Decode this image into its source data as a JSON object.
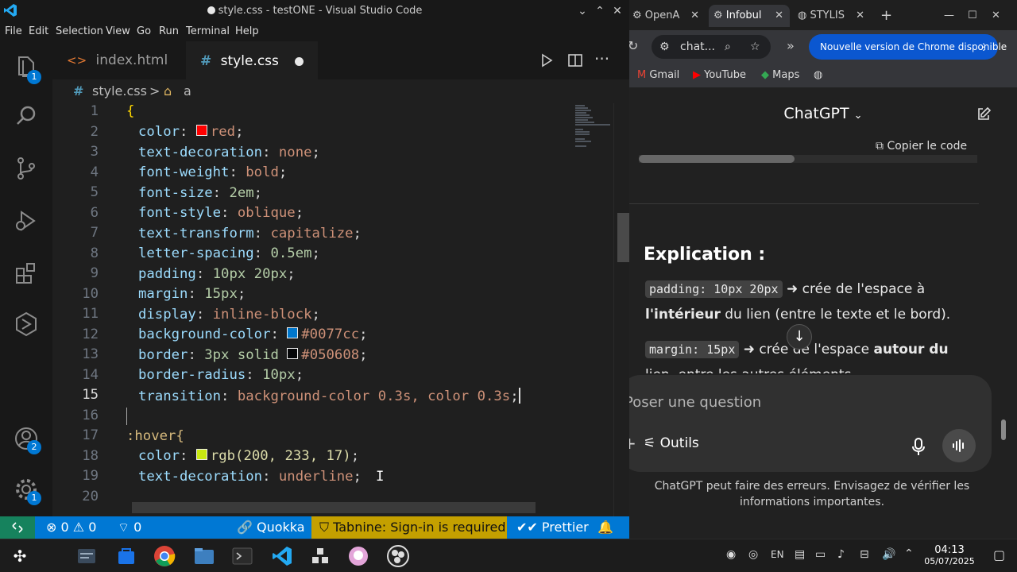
{
  "vscode": {
    "window_title": "style.css - testONE - Visual Studio Code",
    "menu": [
      "File",
      "Edit",
      "Selection",
      "View",
      "Go",
      "Run",
      "Terminal",
      "Help"
    ],
    "activity_badges": {
      "explorer": "1",
      "accounts": "2",
      "settings": "1"
    },
    "tabs": [
      {
        "label": "index.html",
        "icon": "<>",
        "active": false
      },
      {
        "label": "style.css",
        "icon": "#",
        "active": true,
        "modified": true
      }
    ],
    "breadcrumb": {
      "file": "style.css",
      "separator": ">",
      "symbol": "a"
    },
    "line_numbers": [
      "1",
      "2",
      "3",
      "4",
      "5",
      "6",
      "7",
      "8",
      "9",
      "10",
      "11",
      "12",
      "13",
      "14",
      "15",
      "16",
      "17",
      "18",
      "19",
      "20"
    ],
    "active_line": 15,
    "code_lines": {
      "l1": "{",
      "l2_prop": "color",
      "l2_val": "red",
      "l2_swatch": "#ff0000",
      "l3_prop": "text-decoration",
      "l3_val": "none",
      "l4_prop": "font-weight",
      "l4_val": "bold",
      "l5_prop": "font-size",
      "l5_val": "2em",
      "l6_prop": "font-style",
      "l6_val": "oblique",
      "l7_prop": "text-transform",
      "l7_val": "capitalize",
      "l8_prop": "letter-spacing",
      "l8_val": "0.5em",
      "l9_prop": "padding",
      "l9_val": "10px 20px",
      "l10_prop": "margin",
      "l10_val": "15px",
      "l11_prop": "display",
      "l11_val": "inline-block",
      "l12_prop": "background-color",
      "l12_val": "#0077cc",
      "l12_swatch": "#0077cc",
      "l13_prop": "border",
      "l13_val_a": "3px solid ",
      "l13_val_b": "#050608",
      "l13_swatch": "#050608",
      "l14_prop": "border-radius",
      "l14_val": "10px",
      "l15_prop": "transition",
      "l15_val": "background-color 0.3s, color 0.3s",
      "l17_sel": ":hover{",
      "l18_prop": "color",
      "l18_val": "rgb(200, 233, 17)",
      "l18_swatch": "#c8e911",
      "l19_prop": "text-decoration",
      "l19_val": "underline"
    },
    "status": {
      "errors": "0",
      "warnings": "0",
      "ports": "0",
      "quokka": "Quokka",
      "tabnine": "Tabnine: Sign-in is required",
      "prettier": "Prettier"
    }
  },
  "chrome": {
    "tabs": [
      "OpenA",
      "Infobul",
      "STYLIS"
    ],
    "omnibox": "chat...",
    "update_button": "Nouvelle version de Chrome disponible",
    "bookmarks": [
      "Gmail",
      "YouTube",
      "Maps"
    ],
    "chatgpt": {
      "model_title": "ChatGPT",
      "copy_code": "Copier le code",
      "heading": "Explication :",
      "p1_code": "padding: 10px 20px",
      "p1_text_a": " crée de l'espace à",
      "p1_bold": "l'intérieur",
      "p1_text_b": " du lien (entre le texte et le bord).",
      "p2_code": "margin: 15px",
      "p2_text_a": " crée de l'espace ",
      "p2_bold": "autour du",
      "p2_text_b": "lien, entre les autres éléments.",
      "composer_placeholder": "Poser une question",
      "tools_label": "Outils",
      "disclaimer": "ChatGPT peut faire des erreurs. Envisagez de vérifier les informations importantes."
    }
  },
  "taskbar": {
    "language": "EN",
    "time": "04:13",
    "date": "05/07/2025"
  },
  "colors": {
    "vscode_status": "#0078d4",
    "tabnine": "#c4a000",
    "remote": "#16825d",
    "chrome_update": "#0b57d0"
  }
}
